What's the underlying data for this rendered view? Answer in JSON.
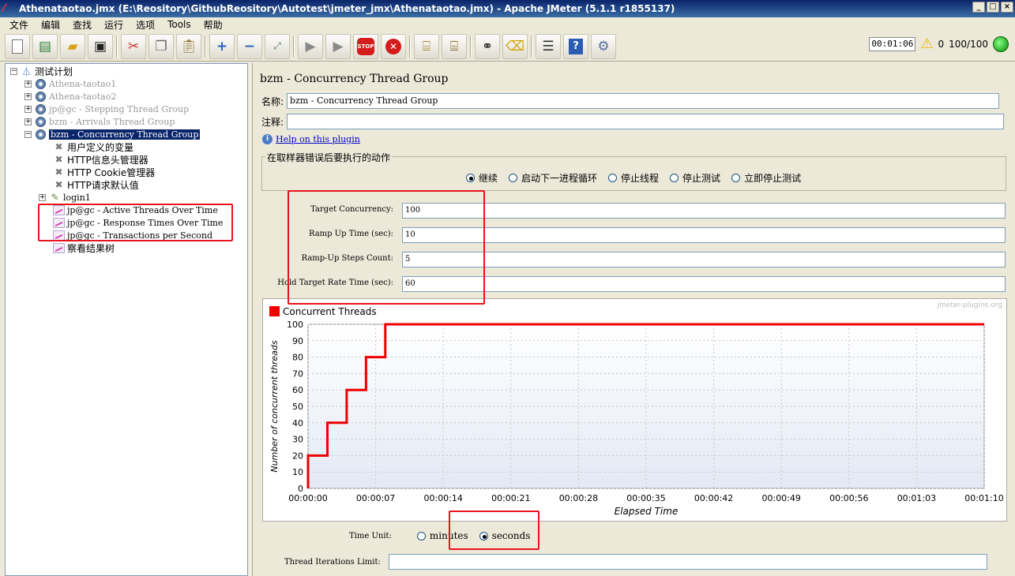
{
  "window": {
    "title": "Athenataotao.jmx (E:\\Reository\\GithubReository\\Autotest\\jmeter_jmx\\Athenataotao.jmx) - Apache JMeter (5.1.1 r1855137)"
  },
  "menu": [
    "文件",
    "编辑",
    "查找",
    "运行",
    "选项",
    "Tools",
    "帮助"
  ],
  "toolbar": {
    "icons": [
      "new-icon",
      "templates-icon",
      "open-icon",
      "save-icon",
      "cut-icon",
      "copy-icon",
      "paste-icon",
      "expand-icon",
      "collapse-icon",
      "toggle-icon",
      "start-icon",
      "start-no-pause-icon",
      "stop-icon",
      "shutdown-icon",
      "clear-icon",
      "clear-all-icon",
      "search-icon",
      "reset-search-icon",
      "function-helper-icon",
      "help-icon",
      "remote-icon"
    ]
  },
  "status": {
    "timer": "00:01:06",
    "warnings": "0",
    "threads": "100/100"
  },
  "tree": {
    "root": "测试计划",
    "nodes": [
      {
        "label": "Athena-taotao1",
        "state": "disabled"
      },
      {
        "label": "Athena-taotao2",
        "state": "disabled"
      },
      {
        "label": "jp@gc - Stepping Thread Group",
        "state": "disabled"
      },
      {
        "label": "bzm - Arrivals Thread Group",
        "state": "disabled"
      },
      {
        "label": "bzm - Concurrency Thread Group",
        "state": "selected"
      }
    ],
    "children": [
      {
        "label": "用户定义的变量",
        "icon": "wrench-icon"
      },
      {
        "label": "HTTP信息头管理器",
        "icon": "wrench-icon"
      },
      {
        "label": "HTTP Cookie管理器",
        "icon": "wrench-icon"
      },
      {
        "label": "HTTP请求默认值",
        "icon": "wrench-icon"
      },
      {
        "label": "login1",
        "icon": "sampler-icon"
      },
      {
        "label": "jp@gc - Active Threads Over Time",
        "icon": "graph-icon"
      },
      {
        "label": "jp@gc - Response Times Over Time",
        "icon": "graph-icon"
      },
      {
        "label": "jp@gc - Transactions per Second",
        "icon": "graph-icon"
      },
      {
        "label": "察看结果树",
        "icon": "graph-icon"
      }
    ]
  },
  "panel": {
    "title": "bzm - Concurrency Thread Group",
    "name_label": "名称:",
    "name_value": "bzm - Concurrency Thread Group",
    "comment_label": "注释:",
    "comment_value": "",
    "help_link": "Help on this plugin",
    "error_group_label": "在取样器错误后要执行的动作",
    "error_options": [
      "继续",
      "启动下一进程循环",
      "停止线程",
      "停止测试",
      "立即停止测试"
    ],
    "error_selected": 0,
    "params": [
      {
        "label": "Target Concurrency:",
        "value": "100"
      },
      {
        "label": "Ramp Up Time (sec):",
        "value": "10"
      },
      {
        "label": "Ramp-Up Steps Count:",
        "value": "5"
      },
      {
        "label": "Hold Target Rate Time (sec):",
        "value": "60"
      }
    ],
    "time_unit_label": "Time Unit:",
    "time_unit_options": [
      "minutes",
      "seconds"
    ],
    "time_unit_selected": 1,
    "iterations_label": "Thread Iterations Limit:",
    "iterations_value": ""
  },
  "chart_data": {
    "type": "line",
    "series": [
      {
        "name": "Concurrent Threads",
        "color": "#ee0000",
        "points": [
          [
            0,
            0
          ],
          [
            0,
            20
          ],
          [
            2,
            20
          ],
          [
            2,
            40
          ],
          [
            4,
            40
          ],
          [
            4,
            60
          ],
          [
            6,
            60
          ],
          [
            6,
            80
          ],
          [
            8,
            80
          ],
          [
            8,
            100
          ],
          [
            70,
            100
          ]
        ]
      }
    ],
    "watermark": "jmeter-plugins.org",
    "xlabel": "Elapsed Time",
    "ylabel": "Number of concurrent threads",
    "x_ticks": [
      "00:00:00",
      "00:00:07",
      "00:00:14",
      "00:00:21",
      "00:00:28",
      "00:00:35",
      "00:00:42",
      "00:00:49",
      "00:00:56",
      "00:01:03",
      "00:01:10"
    ],
    "x_tick_values": [
      0,
      7,
      14,
      21,
      28,
      35,
      42,
      49,
      56,
      63,
      70
    ],
    "y_ticks": [
      0,
      10,
      20,
      30,
      40,
      50,
      60,
      70,
      80,
      90,
      100
    ],
    "xlim": [
      0,
      70
    ],
    "ylim": [
      0,
      100
    ],
    "grid": true,
    "legend": "top-left"
  }
}
